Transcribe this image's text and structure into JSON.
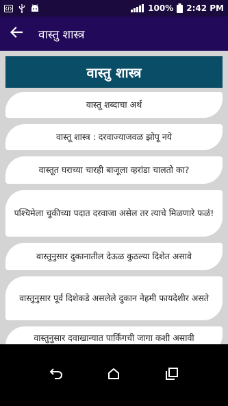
{
  "status_bar": {
    "battery_percent": "100%",
    "time": "2:42 PM",
    "icons": [
      "code-icon",
      "usb-icon",
      "android-icon",
      "signal-icon",
      "battery-icon"
    ]
  },
  "app_bar": {
    "title": "वास्तु शास्त्र",
    "back_icon": "arrow-left-icon"
  },
  "banner": {
    "title": "वास्तु शास्त्र"
  },
  "list": [
    {
      "label": "वास्तू शब्दाचा अर्थ"
    },
    {
      "label": "वास्तू शास्त्र : दरवाज्याजवळ झोपू नये"
    },
    {
      "label": "वास्तूत घराच्या चारही बाजूला व्हरांडा चालतो का?"
    },
    {
      "label": "पश्चिमेला चुकीच्या पदात दरवाजा असेल तर त्याचे मिळणारे फळं!"
    },
    {
      "label": "वास्तुनुसार दुकानातील देऊळ कुठल्या दिशेत असावे"
    },
    {
      "label": "वास्तुनुसार पूर्व दिशेकडे असलेले दुकान नेहमी फायदेशीर असते"
    },
    {
      "label": "वास्तुनुसार दवाखान्यात पार्किंगची जागा कशी असावी"
    }
  ],
  "colors": {
    "status_bar": "#1a0a3d",
    "app_bar": "#22095a",
    "banner": "#0a4d66",
    "background": "#d4d4d4"
  }
}
